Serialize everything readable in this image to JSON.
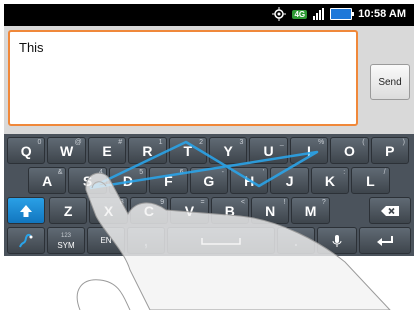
{
  "status_bar": {
    "network": "4G",
    "time": "10:58 AM"
  },
  "compose": {
    "message_text": "This",
    "send_label": "Send"
  },
  "keyboard": {
    "row1": [
      {
        "label": "Q",
        "sup": "0"
      },
      {
        "label": "W",
        "sup": "@"
      },
      {
        "label": "E",
        "sup": "#"
      },
      {
        "label": "R",
        "sup": "1"
      },
      {
        "label": "T",
        "sup": "2"
      },
      {
        "label": "Y",
        "sup": "3"
      },
      {
        "label": "U",
        "sup": "_"
      },
      {
        "label": "I",
        "sup": "%"
      },
      {
        "label": "O",
        "sup": "("
      },
      {
        "label": "P",
        "sup": ")"
      }
    ],
    "row2": [
      {
        "label": "A",
        "sup": "&"
      },
      {
        "label": "S",
        "sup": "4"
      },
      {
        "label": "D",
        "sup": "5"
      },
      {
        "label": "F",
        "sup": "6"
      },
      {
        "label": "G",
        "sup": "-"
      },
      {
        "label": "H",
        "sup": "'"
      },
      {
        "label": "J",
        "sup": ""
      },
      {
        "label": "K",
        "sup": ":"
      },
      {
        "label": "L",
        "sup": "/"
      }
    ],
    "row3": [
      {
        "label": "Z",
        "sup": ""
      },
      {
        "label": "X",
        "sup": "8"
      },
      {
        "label": "C",
        "sup": "9"
      },
      {
        "label": "V",
        "sup": "="
      },
      {
        "label": "B",
        "sup": "<"
      },
      {
        "label": "N",
        "sup": "!"
      },
      {
        "label": "M",
        "sup": "?"
      }
    ],
    "sym_top": "123",
    "sym_label": "SYM",
    "lang_label": "EN"
  },
  "colors": {
    "accent": "#f0883a",
    "shift_blue": "#1e8ad6",
    "swipe_trace": "#2aa3e8"
  },
  "icons": [
    "gps-icon",
    "signal-icon",
    "battery-icon",
    "shift-icon",
    "swype-icon",
    "backspace-icon",
    "enter-icon",
    "mic-icon"
  ]
}
